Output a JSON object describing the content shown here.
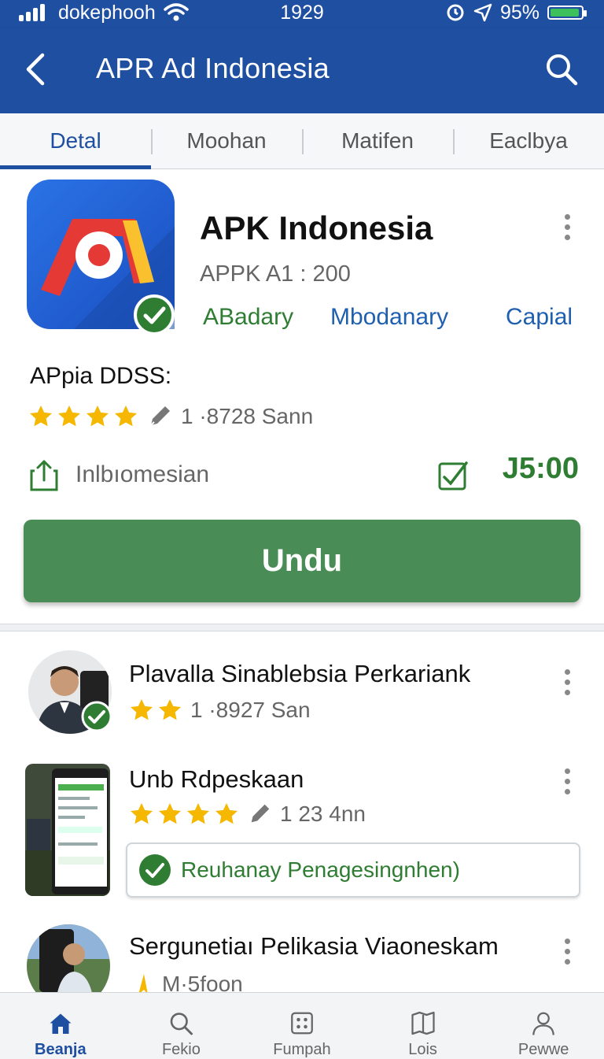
{
  "status_bar": {
    "carrier": "dokephooh",
    "time": "1929",
    "battery": "95%",
    "battery_level": 0.95
  },
  "app_bar": {
    "title": "APR Ad Indonesia"
  },
  "tabs": [
    {
      "label": "Detal",
      "active": true
    },
    {
      "label": "Moohan",
      "active": false
    },
    {
      "label": "Matifen",
      "active": false
    },
    {
      "label": "Eaclbya",
      "active": false
    }
  ],
  "app": {
    "name": "APK Indonesia",
    "version": "APPK A1 : 200",
    "categories": [
      "ABadary",
      "Mbodanary",
      "Capial"
    ],
    "rating_label": "APpia DDSS:",
    "rating_stars": 4,
    "rating_meta": "1 ·8728 Sann",
    "share_label": "Inlbıomesian",
    "price": "J5:00",
    "download_label": "Undu"
  },
  "list": [
    {
      "title": "Plavalla Sinablebsia Perkariank",
      "stars": 2,
      "meta": "1 ·8927 San"
    },
    {
      "title": "Unb Rdpeskaan",
      "stars": 4,
      "meta": "1 23 4nn",
      "chip": "Reuhanay Penagesingnhen)"
    },
    {
      "title": "Sergunetiaı Pelikasia Viaoneskam",
      "meta": "M·5foon"
    }
  ],
  "bottom_nav": [
    {
      "label": "Beanja",
      "icon": "home-icon",
      "active": true
    },
    {
      "label": "Fekio",
      "icon": "search-icon",
      "active": false
    },
    {
      "label": "Fumpah",
      "icon": "grid-icon",
      "active": false
    },
    {
      "label": "Lois",
      "icon": "map-icon",
      "active": false
    },
    {
      "label": "Pewwe",
      "icon": "person-icon",
      "active": false
    }
  ],
  "colors": {
    "primary": "#1f4fa0",
    "download": "#4a8c55",
    "success": "#2e7d32",
    "star": "#f5b700",
    "category_green": "#2e7d32",
    "category_blue": "#1f5fb0"
  }
}
